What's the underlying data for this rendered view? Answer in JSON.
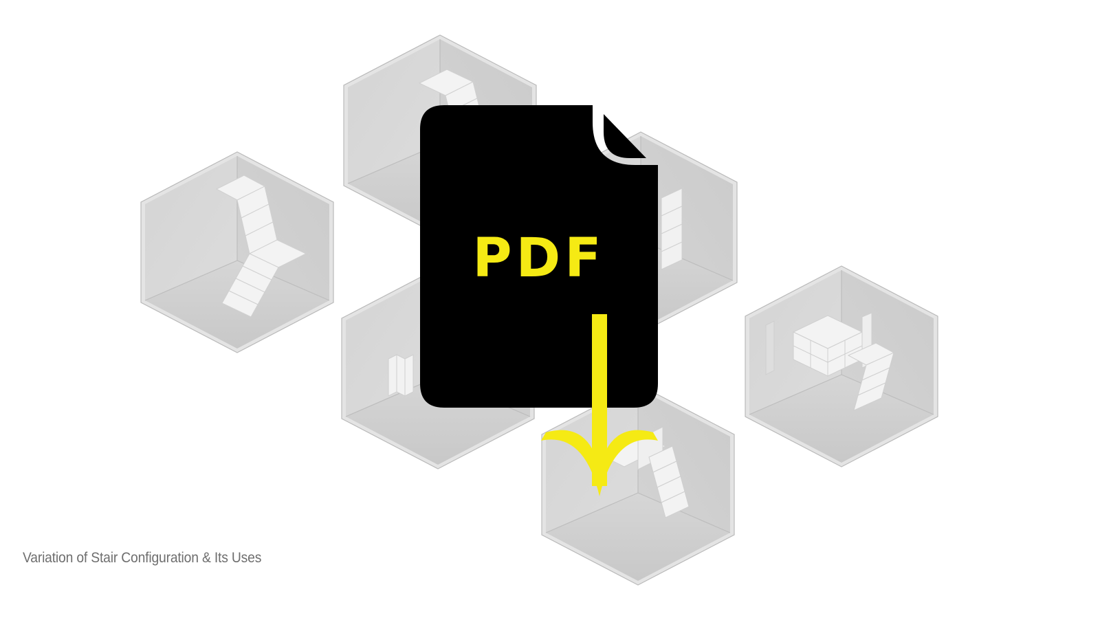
{
  "caption": "Variation of Stair Configuration & Its Uses",
  "pdf_icon": {
    "label": "PDF",
    "icon_name": "pdf-download-icon",
    "document_color": "#000000",
    "accent_color": "#f5ea14"
  },
  "colors": {
    "background": "#ffffff",
    "room_wall_light": "#d9d9d9",
    "room_wall_dark": "#c9c9c9",
    "room_floor": "#cfcfcf",
    "room_edge": "#e9e9e9",
    "stair": "#f2f2f2",
    "caption": "#6e6e6e"
  }
}
